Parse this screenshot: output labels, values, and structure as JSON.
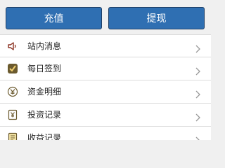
{
  "buttons": {
    "recharge_label": "充值",
    "withdraw_label": "提现"
  },
  "menu": {
    "items": [
      {
        "label": "站内消息",
        "icon": "speaker-icon"
      },
      {
        "label": "每日签到",
        "icon": "checkin-icon"
      },
      {
        "label": "资金明细",
        "icon": "yen-icon"
      },
      {
        "label": "投资记录",
        "icon": "document-yen-icon"
      },
      {
        "label": "收益记录",
        "icon": "document-lines-icon"
      }
    ]
  },
  "colors": {
    "button_blue": "#2f6fb2",
    "icon_dark": "#6b5a2e",
    "icon_red": "#8a2f1f"
  }
}
